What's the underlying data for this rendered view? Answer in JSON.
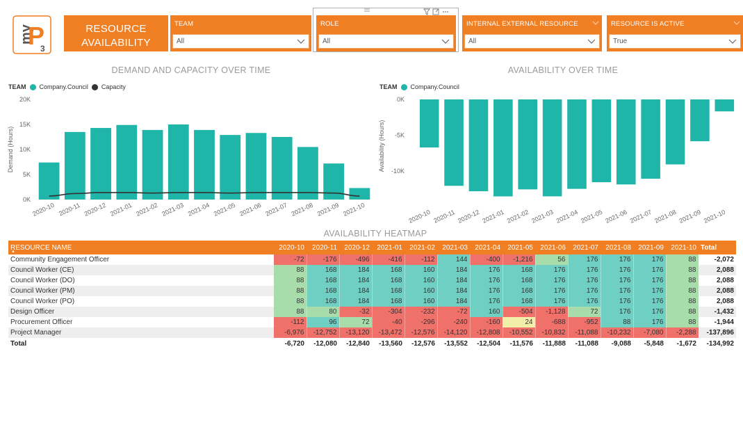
{
  "header": {
    "logo_text_my": "my",
    "logo_text_p": "P",
    "logo_text_3": "3",
    "title_line1": "RESOURCE",
    "title_line2": "AVAILABILITY"
  },
  "filters": [
    {
      "label": "TEAM",
      "value": "All"
    },
    {
      "label": "ROLE",
      "value": "All"
    },
    {
      "label": "INTERNAL EXTERNAL RESOURCE",
      "value": "All"
    },
    {
      "label": "RESOURCE IS ACTIVE",
      "value": "True"
    }
  ],
  "colors": {
    "accent": "#f07f24",
    "teal": "#1fb5a8",
    "capacity_line": "#333333",
    "heat_red": "#f0706a",
    "heat_green": "#a8dcab",
    "heat_teal": "#6fcfc3",
    "heat_yellow": "#f2efa8"
  },
  "demand_chart": {
    "title": "DEMAND AND CAPACITY OVER TIME",
    "legend_title": "TEAM",
    "legend_items": [
      "Company.Council",
      "Capacity"
    ],
    "ylabel": "Demand (Hours)",
    "yticks": [
      "20K",
      "15K",
      "10K",
      "5K",
      "0K"
    ]
  },
  "availability_chart": {
    "title": "AVAILABILITY OVER TIME",
    "legend_title": "TEAM",
    "legend_items": [
      "Company.Council"
    ],
    "ylabel": "Availability (Hours)",
    "yticks": [
      "0K",
      "-5K",
      "-10K"
    ]
  },
  "chart_data": [
    {
      "type": "bar",
      "title": "DEMAND AND CAPACITY OVER TIME",
      "xlabel": "",
      "ylabel": "Demand (Hours)",
      "ylim": [
        0,
        20000
      ],
      "categories": [
        "2020-10",
        "2020-11",
        "2020-12",
        "2021-01",
        "2021-02",
        "2021-03",
        "2021-04",
        "2021-05",
        "2021-06",
        "2021-07",
        "2021-08",
        "2021-09",
        "2021-10"
      ],
      "series": [
        {
          "name": "Company.Council",
          "type": "bar",
          "values": [
            7400,
            13500,
            14300,
            14900,
            13900,
            15000,
            13900,
            12900,
            13300,
            12500,
            10500,
            7200,
            2300
          ]
        },
        {
          "name": "Capacity",
          "type": "line",
          "values": [
            700,
            1200,
            1400,
            1400,
            1300,
            1400,
            1400,
            1300,
            1400,
            1400,
            1400,
            1300,
            700
          ]
        }
      ],
      "grid": false,
      "legend": "top-left"
    },
    {
      "type": "bar",
      "title": "AVAILABILITY OVER TIME",
      "xlabel": "",
      "ylabel": "Availability (Hours)",
      "ylim": [
        -14000,
        0
      ],
      "categories": [
        "2020-10",
        "2020-11",
        "2020-12",
        "2021-01",
        "2021-02",
        "2021-03",
        "2021-04",
        "2021-05",
        "2021-06",
        "2021-07",
        "2021-08",
        "2021-09",
        "2021-10"
      ],
      "series": [
        {
          "name": "Company.Council",
          "values": [
            -6720,
            -12080,
            -12840,
            -13560,
            -12576,
            -13552,
            -12504,
            -11576,
            -11888,
            -11088,
            -9088,
            -5848,
            -1672
          ]
        }
      ],
      "grid": false,
      "legend": "top-left"
    }
  ],
  "heatmap": {
    "title": "AVAILABILITY HEATMAP",
    "name_header": "RESOURCE NAME",
    "total_header": "Total",
    "months": [
      "2020-10",
      "2020-11",
      "2020-12",
      "2021-01",
      "2021-02",
      "2021-03",
      "2021-04",
      "2021-05",
      "2021-06",
      "2021-07",
      "2021-08",
      "2021-09",
      "2021-10"
    ],
    "rows": [
      {
        "name": "Community Engagement Officer",
        "values": [
          "-72",
          "-176",
          "-496",
          "-416",
          "-112",
          "144",
          "-400",
          "-1,216",
          "56",
          "176",
          "176",
          "176",
          "88"
        ],
        "total": "-2,072"
      },
      {
        "name": "Council Worker (CE)",
        "values": [
          "88",
          "168",
          "184",
          "168",
          "160",
          "184",
          "176",
          "168",
          "176",
          "176",
          "176",
          "176",
          "88"
        ],
        "total": "2,088"
      },
      {
        "name": "Council Worker (DO)",
        "values": [
          "88",
          "168",
          "184",
          "168",
          "160",
          "184",
          "176",
          "168",
          "176",
          "176",
          "176",
          "176",
          "88"
        ],
        "total": "2,088"
      },
      {
        "name": "Council Worker (PM)",
        "values": [
          "88",
          "168",
          "184",
          "168",
          "160",
          "184",
          "176",
          "168",
          "176",
          "176",
          "176",
          "176",
          "88"
        ],
        "total": "2,088"
      },
      {
        "name": "Council Worker (PO)",
        "values": [
          "88",
          "168",
          "184",
          "168",
          "160",
          "184",
          "176",
          "168",
          "176",
          "176",
          "176",
          "176",
          "88"
        ],
        "total": "2,088"
      },
      {
        "name": "Design Officer",
        "values": [
          "88",
          "80",
          "-32",
          "-304",
          "-232",
          "-72",
          "160",
          "-504",
          "-1,128",
          "72",
          "176",
          "176",
          "88"
        ],
        "total": "-1,432"
      },
      {
        "name": "Procurement Officer",
        "values": [
          "-112",
          "96",
          "72",
          "-40",
          "-296",
          "-240",
          "-160",
          "24",
          "-688",
          "-952",
          "88",
          "176",
          "88"
        ],
        "total": "-1,944"
      },
      {
        "name": "Project Manager",
        "values": [
          "-6,976",
          "-12,752",
          "-13,120",
          "-13,472",
          "-12,576",
          "-14,120",
          "-12,808",
          "-10,552",
          "-10,832",
          "-11,088",
          "-10,232",
          "-7,080",
          "-2,288"
        ],
        "total": "-137,896"
      }
    ],
    "total_row": {
      "name": "Total",
      "values": [
        "-6,720",
        "-12,080",
        "-12,840",
        "-13,560",
        "-12,576",
        "-13,552",
        "-12,504",
        "-11,576",
        "-11,888",
        "-11,088",
        "-9,088",
        "-5,848",
        "-1,672"
      ],
      "total": "-134,992"
    }
  }
}
